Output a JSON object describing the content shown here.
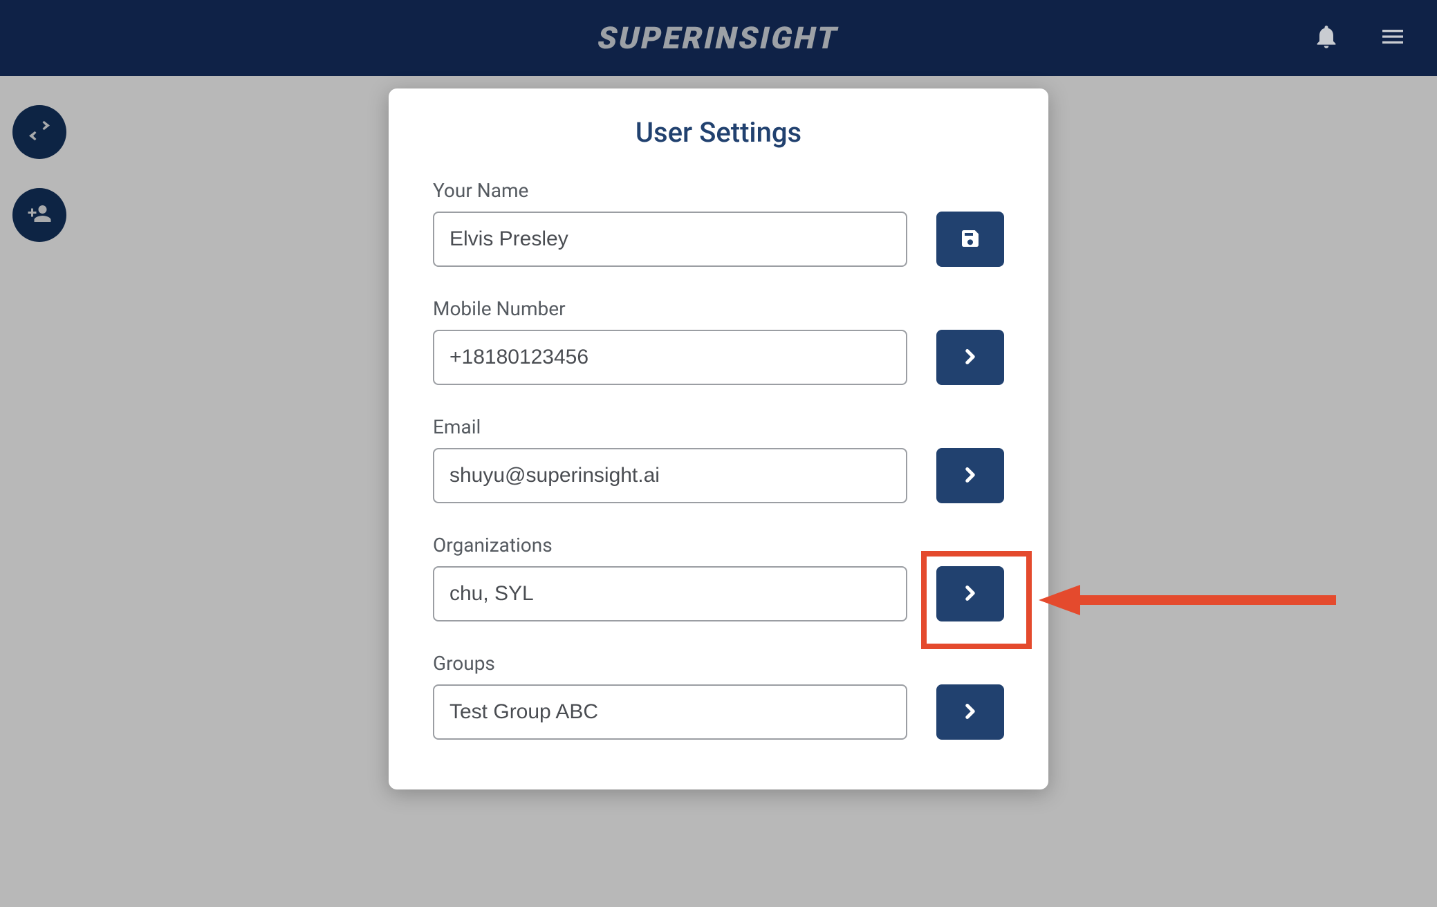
{
  "header": {
    "brand": "SUPERINSIGHT",
    "notifications_icon": "bell",
    "menu_icon": "hamburger"
  },
  "sidebar": {
    "fab_swap_icon": "swap-horizontal",
    "fab_add_user_icon": "person-add"
  },
  "modal": {
    "title": "User Settings",
    "fields": {
      "name": {
        "label": "Your Name",
        "value": "Elvis Presley",
        "action_icon": "save"
      },
      "mobile": {
        "label": "Mobile Number",
        "value": "+18180123456",
        "action_icon": "chevron-right"
      },
      "email": {
        "label": "Email",
        "value": "shuyu@superinsight.ai",
        "action_icon": "chevron-right"
      },
      "organizations": {
        "label": "Organizations",
        "value": "chu, SYL",
        "action_icon": "chevron-right"
      },
      "groups": {
        "label": "Groups",
        "value": "Test Group ABC",
        "action_icon": "chevron-right"
      }
    }
  },
  "annotation": {
    "target": "organizations-action",
    "color": "#e44a2d"
  }
}
